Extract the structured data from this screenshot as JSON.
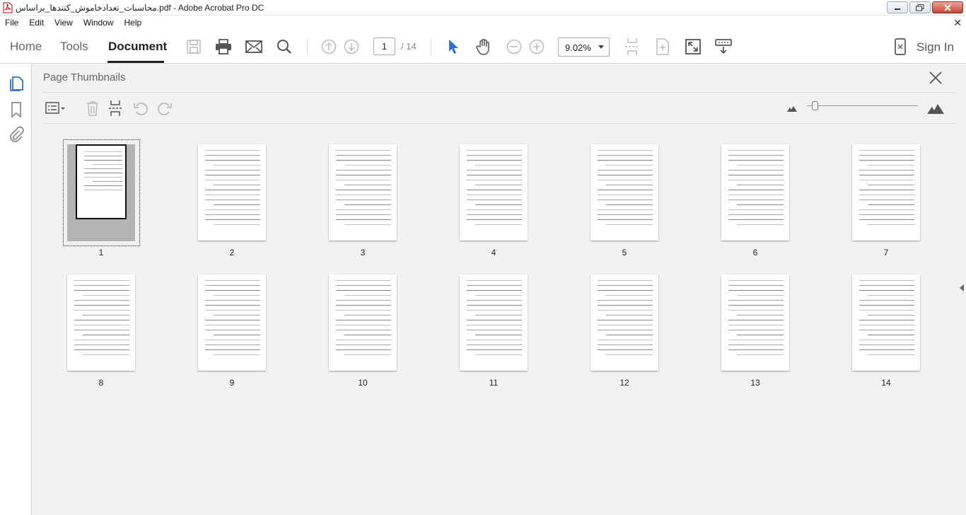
{
  "window": {
    "title": "محاسبات_تعدادخاموش_کنندها_براساس.pdf - Adobe Acrobat Pro DC"
  },
  "menu": {
    "items": [
      "File",
      "Edit",
      "View",
      "Window",
      "Help"
    ]
  },
  "toolbar": {
    "tabs": [
      "Home",
      "Tools",
      "Document"
    ],
    "active_tab": "Document",
    "page_current": "1",
    "page_total": "/ 14",
    "zoom": "9.02%",
    "sign_in": "Sign In"
  },
  "panel": {
    "title": "Page Thumbnails"
  },
  "thumbnails": {
    "pages": [
      "1",
      "2",
      "3",
      "4",
      "5",
      "6",
      "7",
      "8",
      "9",
      "10",
      "11",
      "12",
      "13",
      "14"
    ],
    "selected": "1"
  },
  "colors": {
    "accent_select": "#3b7ddd",
    "background": "#f2f2f2"
  }
}
